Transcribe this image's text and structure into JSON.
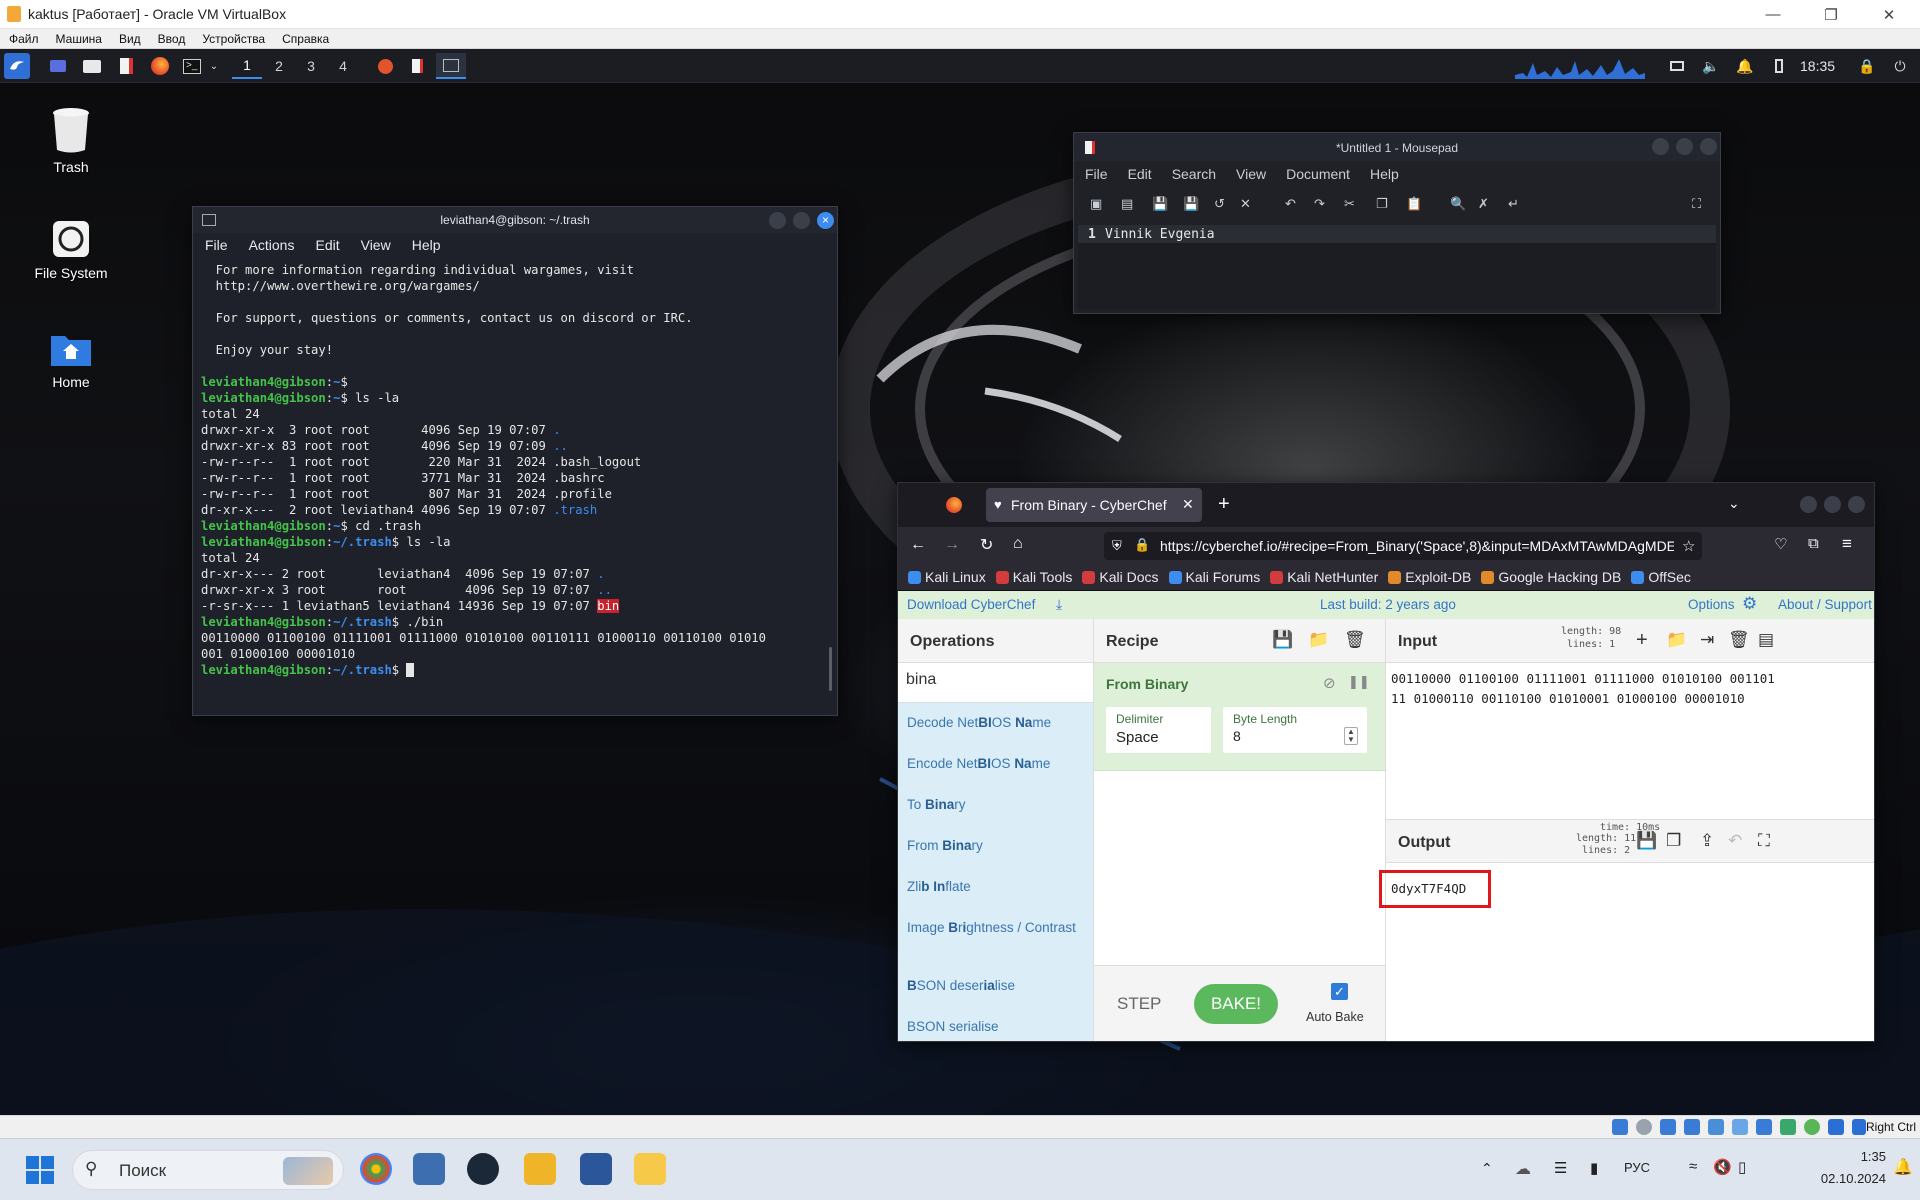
{
  "host": {
    "title": "kaktus [Работает] - Oracle VM VirtualBox",
    "menu": [
      "Файл",
      "Машина",
      "Вид",
      "Ввод",
      "Устройства",
      "Справка"
    ],
    "window_controls": [
      "minimize",
      "restore",
      "close"
    ]
  },
  "panel": {
    "workspaces": [
      "1",
      "2",
      "3",
      "4"
    ],
    "active_workspace": "1",
    "clock": "18:35"
  },
  "desktop": {
    "icons": [
      {
        "label": "Trash",
        "icon": "trash-icon"
      },
      {
        "label": "File System",
        "icon": "drive-icon"
      },
      {
        "label": "Home",
        "icon": "home-folder-icon"
      }
    ]
  },
  "terminal": {
    "title": "leviathan4@gibson: ~/.trash",
    "menu": [
      "File",
      "Actions",
      "Edit",
      "View",
      "Help"
    ],
    "motd": [
      "  For more information regarding individual wargames, visit",
      "  http://www.overthewire.org/wargames/",
      "",
      "  For support, questions or comments, contact us on discord or IRC.",
      "",
      "  Enjoy your stay!",
      ""
    ],
    "user_host": "leviathan4@gibson",
    "cmd1": "ls -la",
    "ls1_total": "total 24",
    "ls1": [
      {
        "meta": "drwxr-xr-x  3 root root       4096 Sep 19 07:07 ",
        "name": ".",
        "type": "dir"
      },
      {
        "meta": "drwxr-xr-x 83 root root       4096 Sep 19 07:09 ",
        "name": "..",
        "type": "dir"
      },
      {
        "meta": "-rw-r--r--  1 root root        220 Mar 31  2024 ",
        "name": ".bash_logout",
        "type": "file"
      },
      {
        "meta": "-rw-r--r--  1 root root       3771 Mar 31  2024 ",
        "name": ".bashrc",
        "type": "file"
      },
      {
        "meta": "-rw-r--r--  1 root root        807 Mar 31  2024 ",
        "name": ".profile",
        "type": "file"
      },
      {
        "meta": "dr-xr-x---  2 root leviathan4 4096 Sep 19 07:07 ",
        "name": ".trash",
        "type": "dir"
      }
    ],
    "cmd2": "cd .trash",
    "cmd3": "ls -la",
    "ls2_total": "total 24",
    "ls2": [
      {
        "meta": "dr-xr-x--- 2 root       leviathan4  4096 Sep 19 07:07 ",
        "name": ".",
        "type": "dir"
      },
      {
        "meta": "drwxr-xr-x 3 root       root        4096 Sep 19 07:07 ",
        "name": "..",
        "type": "dir"
      },
      {
        "meta": "-r-sr-x--- 1 leviathan5 leviathan4 14936 Sep 19 07:07 ",
        "name": "bin",
        "type": "suid"
      }
    ],
    "cmd4": "./bin",
    "output": [
      "00110000 01100100 01111001 01111000 01010100 00110111 01000110 00110100 01010",
      "001 01000100 00001010"
    ]
  },
  "mousepad": {
    "title": "*Untitled 1 - Mousepad",
    "menu": [
      "File",
      "Edit",
      "Search",
      "View",
      "Document",
      "Help"
    ],
    "line_number": "1",
    "line_text": "Vinnik Evgenia"
  },
  "firefox": {
    "tab_title": "From Binary - CyberChef",
    "url": "https://cyberchef.io/#recipe=From_Binary('Space',8)&input=MDAxMTAwMDAgMDExMDAxMDA",
    "bookmarks": [
      {
        "label": "Kali Linux",
        "color": "#3d8cf0"
      },
      {
        "label": "Kali Tools",
        "color": "#d23c3c"
      },
      {
        "label": "Kali Docs",
        "color": "#d23c3c"
      },
      {
        "label": "Kali Forums",
        "color": "#3d8cf0"
      },
      {
        "label": "Kali NetHunter",
        "color": "#d23c3c"
      },
      {
        "label": "Exploit-DB",
        "color": "#e08a2c"
      },
      {
        "label": "Google Hacking DB",
        "color": "#e08a2c"
      },
      {
        "label": "OffSec",
        "color": "#3d8cf0"
      }
    ]
  },
  "cyberchef": {
    "download": "Download CyberChef",
    "last_build": "Last build: 2 years ago",
    "options": "Options",
    "about": "About / Support",
    "operations_title": "Operations",
    "search_value": "bina",
    "operations": [
      {
        "pre": "Decode Net",
        "bold": "BI",
        "post": "OS ",
        "bold2": "Na",
        "post2": "me"
      },
      {
        "pre": "Encode Net",
        "bold": "BI",
        "post": "OS ",
        "bold2": "Na",
        "post2": "me"
      },
      {
        "pre": "To ",
        "bold": "Bina",
        "post": "ry",
        "bold2": "",
        "post2": ""
      },
      {
        "pre": "From ",
        "bold": "Bina",
        "post": "ry",
        "bold2": "",
        "post2": ""
      },
      {
        "pre": "Zli",
        "bold": "b",
        "post": " ",
        "bold2": "In",
        "post2": "flate"
      },
      {
        "pre": "Image ",
        "bold": "B",
        "post": "r",
        "bold2": "i",
        "post2": "ghtness / Contrast"
      },
      {
        "pre": "",
        "bold": "B",
        "post": "SON deser",
        "bold2": "ia",
        "post2": "lise"
      },
      {
        "pre": "BSON serialise",
        "bold": "",
        "post": "",
        "bold2": "",
        "post2": ""
      }
    ],
    "recipe_title": "Recipe",
    "recipe_op": "From Binary",
    "delimiter_label": "Delimiter",
    "delimiter_value": "Space",
    "byte_length_label": "Byte Length",
    "byte_length_value": "8",
    "step": "STEP",
    "bake": "BAKE!",
    "auto_bake": "Auto Bake",
    "input_title": "Input",
    "input_length": "length: 98",
    "input_lines": "lines:  1",
    "input_text": "00110000 01100100 01111001 01111000 01010100 00110111 01000110 00110100 01010001 01000100 00001010",
    "output_title": "Output",
    "output_time": "time: 10ms",
    "output_length": "length:  11",
    "output_lines": "lines:  2",
    "output_text": "0dyxT7F4QD",
    "output_highlight_color": "#e0161b"
  },
  "host_status": {
    "host_key": "Right Ctrl"
  },
  "taskbar": {
    "search_placeholder": "Поиск",
    "lang": "РУС",
    "time": "1:35",
    "date": "02.10.2024",
    "apps": [
      "windows-start-icon",
      "chrome-icon",
      "virtualbox-icon",
      "steam-icon",
      "notes-icon",
      "word-icon",
      "explorer-icon"
    ]
  }
}
